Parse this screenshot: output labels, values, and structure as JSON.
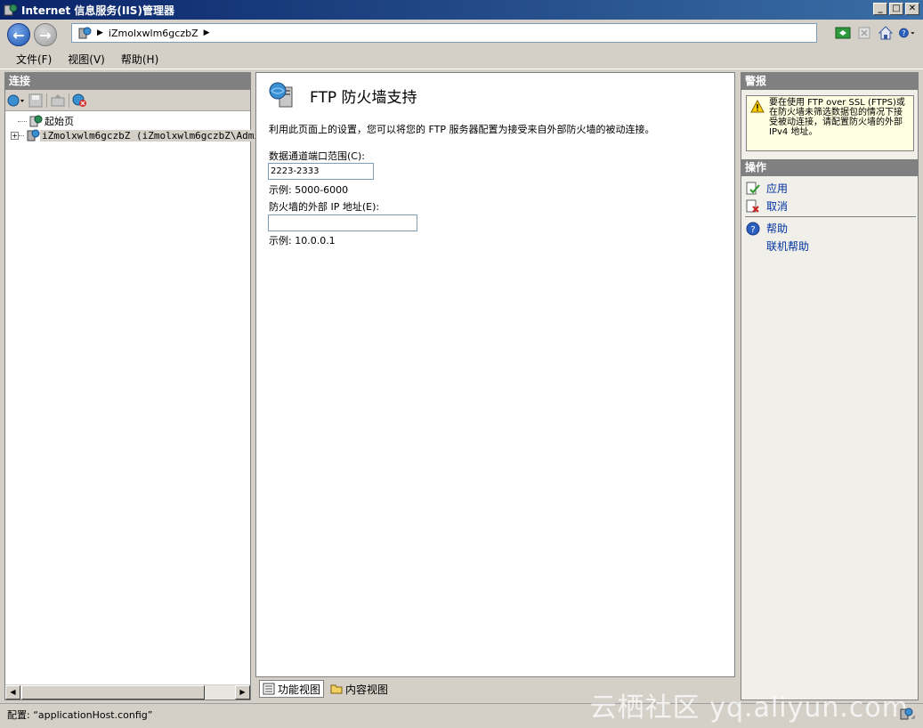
{
  "window": {
    "title": "Internet 信息服务(IIS)管理器"
  },
  "address": {
    "crumbs": [
      "iZmolxwlm6gczbZ"
    ]
  },
  "menu": {
    "file": "文件(F)",
    "view": "视图(V)",
    "help": "帮助(H)"
  },
  "connections": {
    "title": "连接",
    "tree": [
      {
        "label": "起始页"
      },
      {
        "label": "iZmolxwlm6gczbZ (iZmolxwlm6gczbZ\\Admini"
      }
    ]
  },
  "feature": {
    "title": "FTP 防火墙支持",
    "description": "利用此页面上的设置，您可以将您的 FTP 服务器配置为接受来自外部防火墙的被动连接。",
    "port_range_label": "数据通道端口范围(C):",
    "port_range_value": "2223-2333",
    "port_range_example": "示例: 5000-6000",
    "external_ip_label": "防火墙的外部 IP 地址(E):",
    "external_ip_value": "",
    "external_ip_example": "示例: 10.0.0.1"
  },
  "bottom_tabs": {
    "features_view": "功能视图",
    "content_view": "内容视图"
  },
  "alerts": {
    "title": "警报",
    "message": "要在使用 FTP over SSL (FTPS)或在防火墙未筛选数据包的情况下接受被动连接，请配置防火墙的外部 IPv4 地址。"
  },
  "actions": {
    "title": "操作",
    "apply": "应用",
    "cancel": "取消",
    "help": "帮助",
    "online_help": "联机帮助"
  },
  "status": {
    "text": "配置: “applicationHost.config”"
  },
  "watermark": "云栖社区 yq.aliyun.com"
}
